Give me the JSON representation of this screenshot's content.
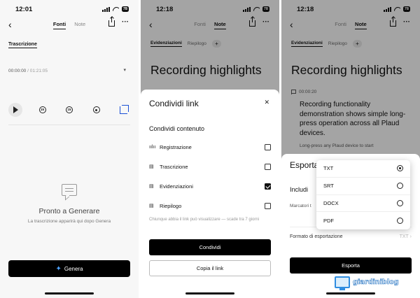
{
  "screen1": {
    "status": {
      "time": "12:01",
      "battery": "78"
    },
    "nav": {
      "tab_sources": "Fonti",
      "tab_notes": "Note"
    },
    "section_label": "Trascrizione",
    "player": {
      "current": "00:00:00",
      "total": "/ 01:21:05",
      "skip_back": "15",
      "skip_fwd": "15"
    },
    "empty_title": "Pronto a Generare",
    "empty_subtitle": "La trascrizione apparirà qui dopo Genera",
    "generate_label": "Genera"
  },
  "screen2": {
    "status": {
      "time": "12:18",
      "battery": "78"
    },
    "nav": {
      "tab_sources": "Fonti",
      "tab_notes": "Note"
    },
    "subtabs": {
      "highlights": "Evidenziazioni",
      "summary": "Riepilogo",
      "plus": "+"
    },
    "page_title": "Recording highlights",
    "sheet": {
      "title": "Condividi link",
      "content_heading": "Condividi contenuto",
      "options": [
        {
          "label": "Registrazione",
          "checked": false
        },
        {
          "label": "Trascrizione",
          "checked": false
        },
        {
          "label": "Evidenziazioni",
          "checked": true
        },
        {
          "label": "Riepilogo",
          "checked": false
        }
      ],
      "note": "Chiunque abbia il link può visualizzare — scade tra 7 giorni",
      "share_button": "Condividi",
      "copy_button": "Copia il link"
    }
  },
  "screen3": {
    "status": {
      "time": "12:18",
      "battery": "78"
    },
    "nav": {
      "tab_sources": "Fonti",
      "tab_notes": "Note"
    },
    "subtabs": {
      "highlights": "Evidenziazioni",
      "summary": "Riepilogo",
      "plus": "+"
    },
    "page_title": "Recording highlights",
    "highlight": {
      "timestamp": "00:00:20",
      "text": "Recording functionality demonstration shows simple long-press operation across all Plaud devices.",
      "subtext": "Long-press any Plaud device to start"
    },
    "sheet": {
      "title": "Esporta",
      "include_heading": "Includi",
      "markers_label": "Marcatori t",
      "format_label": "Formato di esportazione",
      "format_value": "TXT",
      "export_button": "Esporta"
    },
    "format_options": [
      {
        "label": "TXT",
        "selected": true
      },
      {
        "label": "SRT",
        "selected": false
      },
      {
        "label": "DOCX",
        "selected": false
      },
      {
        "label": "PDF",
        "selected": false
      }
    ]
  },
  "watermark": "giardiniblog"
}
